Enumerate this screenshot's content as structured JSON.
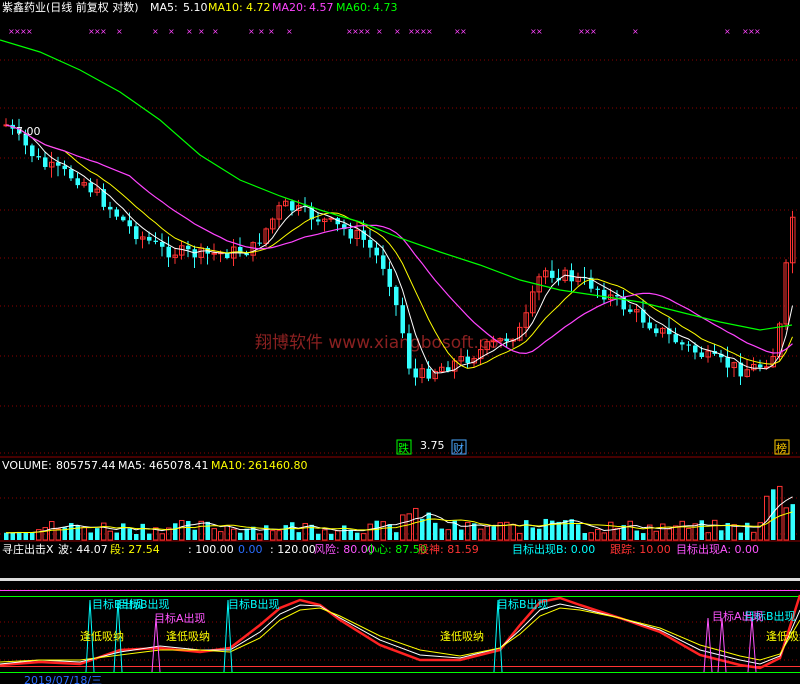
{
  "header": {
    "title": "紫鑫药业(日线 前复权 对数)",
    "ma5_label": "MA5:",
    "ma5_value": "5.10",
    "ma10_label": "MA10:",
    "ma10_value": "4.72",
    "ma20_label": "MA20:",
    "ma20_value": "4.57",
    "ma60_label": "MA60:",
    "ma60_value": "4.73"
  },
  "price_panel": {
    "high_label": "7.00",
    "low_label": "3.75",
    "watermark": "翔博软件 www.xiangbosoft.com",
    "badges": [
      {
        "text": "跌",
        "color": "#00ff00"
      },
      {
        "text": "财",
        "color": "#4aa8ff"
      },
      {
        "text": "榜",
        "color": "#ffcc00"
      }
    ]
  },
  "volume_panel": {
    "volume_label": "VOLUME:",
    "volume_value": "805757.44",
    "ma5_label": "MA5:",
    "ma5_value": "465078.41",
    "ma10_label": "MA10:",
    "ma10_value": "261460.80"
  },
  "indicator_panel": {
    "name": "寻庄出击X",
    "items": [
      {
        "text": "波: 44.07",
        "color": "#ffffff"
      },
      {
        "text": "段: 27.54",
        "color": "#ffff00"
      },
      {
        "text": ": 100.00",
        "color": "#ffffff"
      },
      {
        "text": "0.00",
        "color": "#2a6dff"
      },
      {
        "text": ": 120.00",
        "color": "#ffffff"
      },
      {
        "text": "风险: 80.00",
        "color": "#ff55ff"
      },
      {
        "text": "小心: 87.50",
        "color": "#00ff00"
      },
      {
        "text": "股神: 81.59",
        "color": "#ff3333"
      },
      {
        "text": "目标出现B: 0.00",
        "color": "#00ffff"
      },
      {
        "text": "跟踪: 10.00",
        "color": "#ff3333"
      },
      {
        "text": "目标出现A: 0.00",
        "color": "#ff55ff"
      }
    ],
    "signals": [
      {
        "text": "目标B出现",
        "color": "#00ffff"
      },
      {
        "text": "目标A出现",
        "color": "#ff55ff"
      },
      {
        "text": "逢低吸纳",
        "color": "#ffff00"
      }
    ],
    "bottom_date": "2019/07/18/三"
  },
  "colors": {
    "up": "#ff3333",
    "down": "#33ffff",
    "ma5": "#ffffff",
    "ma10": "#ffff00",
    "ma20": "#ff44ff",
    "ma60": "#00ff00",
    "grid": "#8b0000"
  }
}
